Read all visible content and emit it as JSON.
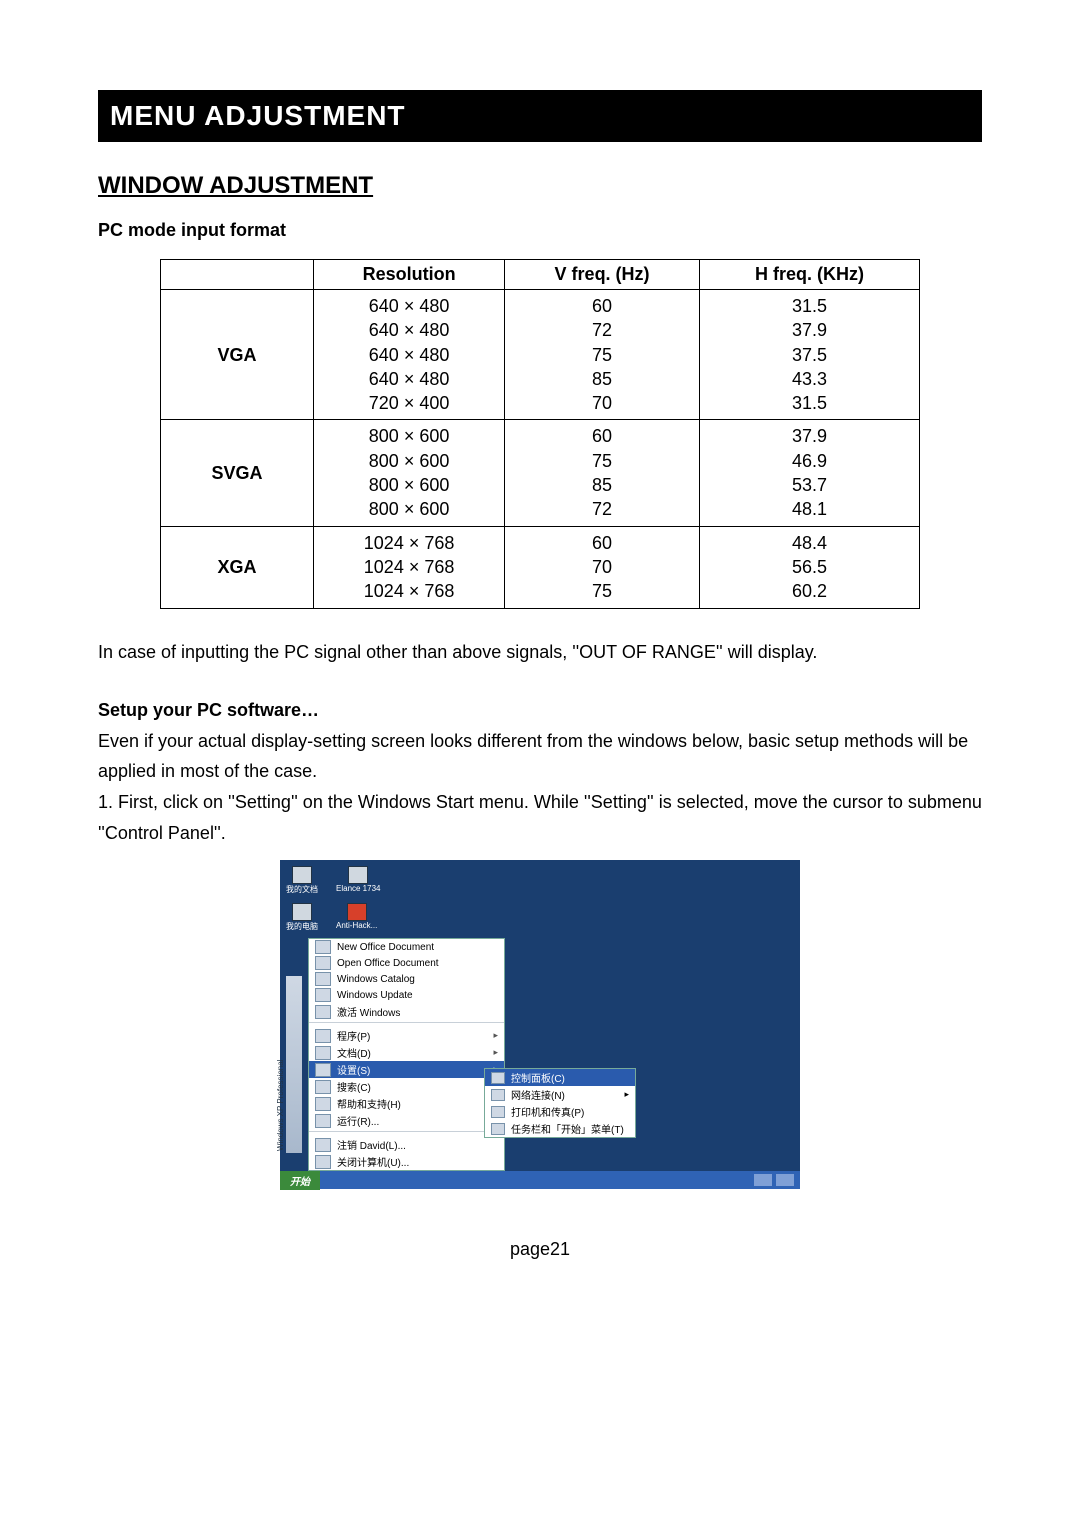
{
  "header": {
    "title": "MENU ADJUSTMENT"
  },
  "section": {
    "title": "WINDOW ADJUSTMENT"
  },
  "subhead": "PC mode input format",
  "table": {
    "headers": {
      "empty": "",
      "res": "Resolution",
      "v": "V freq. (Hz)",
      "h": "H freq. (KHz)"
    },
    "groups": [
      {
        "name": "VGA",
        "rows": [
          {
            "res": "640 × 480",
            "v": "60",
            "h": "31.5"
          },
          {
            "res": "640 × 480",
            "v": "72",
            "h": "37.9"
          },
          {
            "res": "640 × 480",
            "v": "75",
            "h": "37.5"
          },
          {
            "res": "640 × 480",
            "v": "85",
            "h": "43.3"
          },
          {
            "res": "720 × 400",
            "v": "70",
            "h": "31.5"
          }
        ]
      },
      {
        "name": "SVGA",
        "rows": [
          {
            "res": "800 × 600",
            "v": "60",
            "h": "37.9"
          },
          {
            "res": "800 × 600",
            "v": "75",
            "h": "46.9"
          },
          {
            "res": "800 × 600",
            "v": "85",
            "h": "53.7"
          },
          {
            "res": "800 × 600",
            "v": "72",
            "h": "48.1"
          }
        ]
      },
      {
        "name": "XGA",
        "rows": [
          {
            "res": "1024 × 768",
            "v": "60",
            "h": "48.4"
          },
          {
            "res": "1024 × 768",
            "v": "70",
            "h": "56.5"
          },
          {
            "res": "1024 × 768",
            "v": "75",
            "h": "60.2"
          }
        ]
      }
    ]
  },
  "para1": "In case of inputting the PC signal other than above signals, ''OUT OF RANGE'' will display.",
  "setup_head": "Setup your PC software…",
  "para2a": "Even if your actual display-setting screen looks different from the windows below, basic setup methods will be applied in most of the case.",
  "para2b": "1. First, click on ''Setting'' on the Windows Start menu. While ''Setting'' is selected, move the cursor to submenu ''Control Panel''.",
  "shot": {
    "desk_icons": [
      {
        "label": "我的文档"
      },
      {
        "label": "Elance 1734"
      },
      {
        "label": ""
      },
      {
        "label": ""
      }
    ],
    "row2_icons": [
      {
        "label": "我的电脑"
      },
      {
        "label": "Anti-Hack..."
      }
    ],
    "vbar_text": "Windows XP Professional",
    "start_items": [
      {
        "label": "New Office Document"
      },
      {
        "label": "Open Office Document"
      },
      {
        "label": "Windows Catalog"
      },
      {
        "label": "Windows Update"
      },
      {
        "label": "激活 Windows"
      },
      {
        "label": "程序(P)",
        "arrow": "▸"
      },
      {
        "label": "文档(D)",
        "arrow": "▸"
      },
      {
        "label": "设置(S)",
        "arrow": "▸",
        "selected": true
      },
      {
        "label": "搜索(C)",
        "arrow": "▸"
      },
      {
        "label": "帮助和支持(H)"
      },
      {
        "label": "运行(R)..."
      },
      {
        "label": "注销 David(L)..."
      },
      {
        "label": "关闭计算机(U)..."
      }
    ],
    "submenu": [
      {
        "label": "控制面板(C)",
        "selected": true
      },
      {
        "label": "网络连接(N)",
        "arrow": "▸"
      },
      {
        "label": "打印机和传真(P)"
      },
      {
        "label": "任务栏和「开始」菜单(T)"
      }
    ],
    "taskbar": {
      "start": "开始"
    }
  },
  "page_num": "page21"
}
